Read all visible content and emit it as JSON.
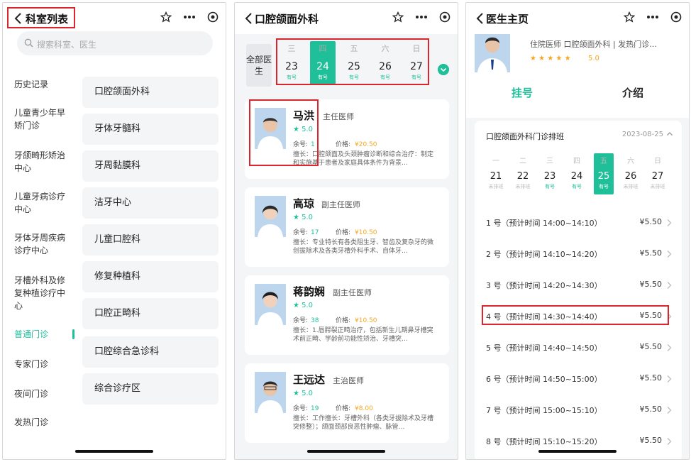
{
  "colors": {
    "accent": "#1fbf9a",
    "price": "#f5a623",
    "highlight_box": "#d9252b"
  },
  "panel1": {
    "title": "科室列表",
    "search_placeholder": "搜索科室、医生",
    "sidebar": [
      {
        "label": "历史记录"
      },
      {
        "label": "儿童青少年早矫门诊"
      },
      {
        "label": "牙颌畸形矫治中心"
      },
      {
        "label": "儿童牙病诊疗中心"
      },
      {
        "label": "牙体牙周疾病诊疗中心"
      },
      {
        "label": "牙槽外科及修复种植诊疗中心"
      },
      {
        "label": "普通门诊",
        "active": true
      },
      {
        "label": "专家门诊"
      },
      {
        "label": "夜间门诊"
      },
      {
        "label": "发热门诊"
      }
    ],
    "departments": [
      {
        "label": "口腔颌面外科"
      },
      {
        "label": "牙体牙髓科"
      },
      {
        "label": "牙周黏膜科"
      },
      {
        "label": "洁牙中心"
      },
      {
        "label": "儿童口腔科"
      },
      {
        "label": "修复种植科"
      },
      {
        "label": "口腔正畸科"
      },
      {
        "label": "口腔综合急诊科"
      },
      {
        "label": "综合诊疗区"
      }
    ]
  },
  "panel2": {
    "title": "口腔颌面外科",
    "all_doctors": "全部医生",
    "days": [
      {
        "weekday": "三",
        "date": "23",
        "status": "有号"
      },
      {
        "weekday": "四",
        "date": "24",
        "status": "有号",
        "selected": true
      },
      {
        "weekday": "五",
        "date": "25",
        "status": "有号"
      },
      {
        "weekday": "六",
        "date": "26",
        "status": "有号"
      },
      {
        "weekday": "日",
        "date": "27",
        "status": "有号"
      }
    ],
    "doctors": [
      {
        "name": "马洪",
        "title": "主任医师",
        "rating": "★ 5.0",
        "remain_label": "余号:",
        "remain": "1",
        "price_label": "价格:",
        "price": "¥20.50",
        "skill": "擅长：口腔颌面及头颈肿瘤诊断和综合治疗：制定和实施基于患者及家庭具体条件为背景…"
      },
      {
        "name": "高琼",
        "title": "副主任医师",
        "rating": "★ 5.0",
        "remain_label": "余号:",
        "remain": "17",
        "price_label": "价格:",
        "price": "¥10.50",
        "skill": "擅长：专业特长有各类阻生牙、智齿及复杂牙的微创拔除术及各类牙槽外科手术、自体牙…"
      },
      {
        "name": "蒋韵娴",
        "title": "副主任医师",
        "rating": "★ 5.0",
        "remain_label": "余号:",
        "remain": "38",
        "price_label": "价格:",
        "price": "¥10.50",
        "skill": "擅长：1.唇腭裂正畸治疗，包括新生儿期鼻牙槽突术前正畸、学龄前功能性矫治、牙槽突…"
      },
      {
        "name": "王远达",
        "title": "主治医师",
        "rating": "★ 5.0",
        "remain_label": "余号:",
        "remain": "19",
        "price_label": "价格:",
        "price": "¥8.00",
        "skill": "擅长：工作擅长：牙槽外科（各类牙拔除术及牙槽突修整）；颌面颈部良恶性肿瘤、脉管…"
      }
    ]
  },
  "panel3": {
    "title": "医生主页",
    "doctor_info": "住院医师  口腔颌面外科 | 发热门诊...",
    "stars": "★ ★ ★ ★ ★",
    "score": "5.0",
    "tabs": {
      "register": "挂号",
      "intro": "介绍"
    },
    "schedule_title": "口腔颌面外科门诊排班",
    "schedule_date": "2023-08-25",
    "days": [
      {
        "weekday": "一",
        "date": "21",
        "status": "未排班"
      },
      {
        "weekday": "二",
        "date": "22",
        "status": "未排班"
      },
      {
        "weekday": "三",
        "date": "23",
        "status": "有号"
      },
      {
        "weekday": "四",
        "date": "24",
        "status": "有号"
      },
      {
        "weekday": "五",
        "date": "25",
        "status": "有号",
        "selected": true
      },
      {
        "weekday": "六",
        "date": "26",
        "status": "未排班"
      },
      {
        "weekday": "日",
        "date": "27",
        "status": "未排班"
      }
    ],
    "slots": [
      {
        "label": "1 号（预计时间 14:00~14:10）",
        "fee": "¥5.50"
      },
      {
        "label": "2 号（预计时间 14:10~14:20）",
        "fee": "¥5.50"
      },
      {
        "label": "3 号（预计时间 14:20~14:30）",
        "fee": "¥5.50"
      },
      {
        "label": "4 号（预计时间 14:30~14:40）",
        "fee": "¥5.50"
      },
      {
        "label": "5 号（预计时间 14:40~14:50）",
        "fee": "¥5.50"
      },
      {
        "label": "6 号（预计时间 14:50~15:00）",
        "fee": "¥5.50"
      },
      {
        "label": "7 号（预计时间 15:00~15:10）",
        "fee": "¥5.50"
      },
      {
        "label": "8 号（预计时间 15:10~15:20）",
        "fee": "¥5.50"
      }
    ]
  }
}
